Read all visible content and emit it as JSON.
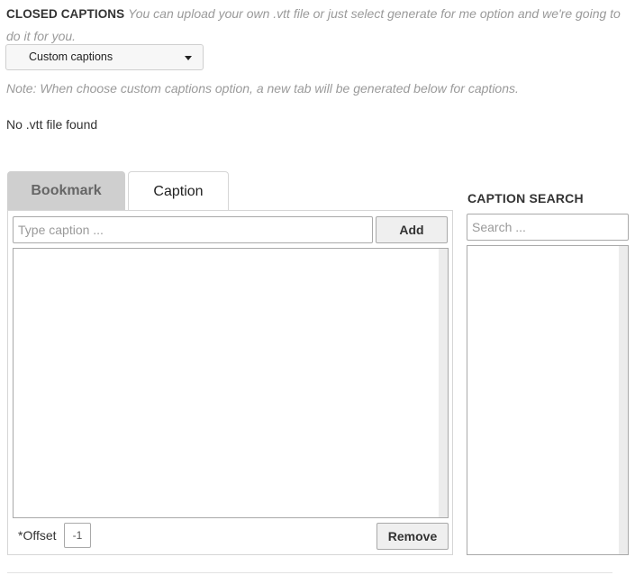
{
  "closed_captions": {
    "title": "CLOSED CAPTIONS",
    "description": "You can upload your own .vtt file or just select generate for me option and we're going to do it for you.",
    "mode_select": {
      "selected": "Custom captions"
    },
    "note": "Note: When choose custom captions option, a new tab will be generated below for captions.",
    "vtt_status": "No .vtt file found"
  },
  "tabs": [
    {
      "label": "Bookmark",
      "active": false
    },
    {
      "label": "Caption",
      "active": true
    }
  ],
  "caption_editor": {
    "input_placeholder": "Type caption ...",
    "add_label": "Add",
    "offset_label": "*Offset",
    "offset_value": "-1",
    "remove_label": "Remove"
  },
  "caption_search": {
    "title": "CAPTION SEARCH",
    "placeholder": "Search ..."
  }
}
